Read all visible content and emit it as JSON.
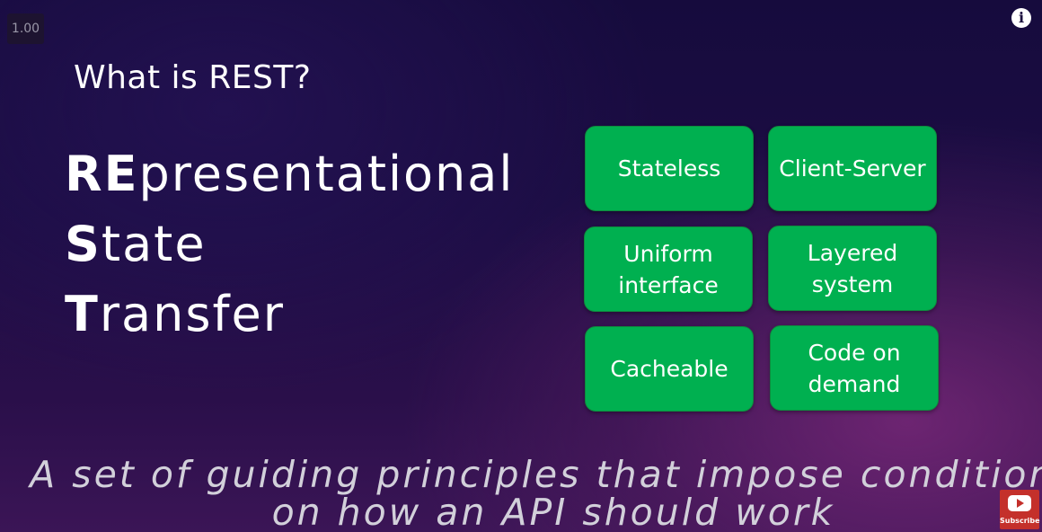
{
  "player": {
    "speed": "1.00",
    "info_icon": "info-icon",
    "subscribe_label": "Subscribe",
    "subscribe_icon": "youtube-logo-icon"
  },
  "slide": {
    "title": "What is REST?",
    "acronym": [
      {
        "initial": "RE",
        "rest": "presentational"
      },
      {
        "initial": "S",
        "rest": "tate"
      },
      {
        "initial": "T",
        "rest": "ransfer"
      }
    ],
    "principles": [
      {
        "line1": "Stateless",
        "line2": ""
      },
      {
        "line1": "Client-Server",
        "line2": ""
      },
      {
        "line1": "Uniform",
        "line2": "interface"
      },
      {
        "line1": "Layered",
        "line2": "system"
      },
      {
        "line1": "Cacheable",
        "line2": ""
      },
      {
        "line1": "Code on",
        "line2": "demand"
      }
    ],
    "tagline_line1": "A set of guiding principles that impose conditions",
    "tagline_line2": "on how an API should work"
  },
  "colors": {
    "box_green": "#00b050",
    "background": "#1c0d44",
    "accent_purple": "#5a1e64"
  }
}
